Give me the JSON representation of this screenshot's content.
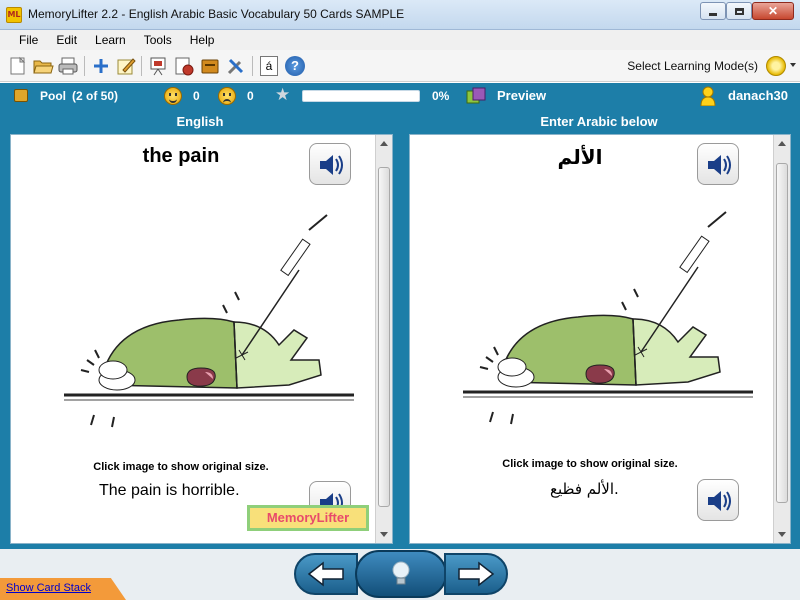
{
  "window": {
    "title": "MemoryLifter 2.2 - English Arabic Basic Vocabulary 50 Cards SAMPLE",
    "app_icon_text": "ML"
  },
  "menu": [
    "File",
    "Edit",
    "Learn",
    "Tools",
    "Help"
  ],
  "toolbar": {
    "icons": [
      "new-icon",
      "open-icon",
      "print-icon",
      "add-icon",
      "edit-icon",
      "slideshow-icon",
      "statistics-icon",
      "card-box-icon",
      "settings-icon",
      "character-map-icon",
      "help-icon"
    ],
    "learning_mode_label": "Select Learning Mode(s)",
    "character_map_glyph": "á",
    "help_glyph": "?"
  },
  "status": {
    "pool_label": "Pool",
    "pool_count": "(2 of 50)",
    "correct_count": "0",
    "wrong_count": "0",
    "progress_percent": 0,
    "progress_text": "0%",
    "preview_label": "Preview",
    "user_name": "danach30",
    "colors": {
      "bar": "#1d7ea8"
    }
  },
  "question": {
    "column_title": "English",
    "word": "the pain",
    "hint": "Click image to show original size.",
    "example": "The pain is horrible.",
    "logo_text": "MemoryLifter"
  },
  "answer": {
    "column_title": "Enter Arabic below",
    "word": "الألم",
    "hint": "Click image to show original size.",
    "example": "الألم فظيع."
  },
  "bottom": {
    "show_card_stack": "Show Card Stack",
    "prev_icon": "arrow-left-icon",
    "hint_icon": "lightbulb-icon",
    "next_icon": "arrow-right-icon"
  }
}
